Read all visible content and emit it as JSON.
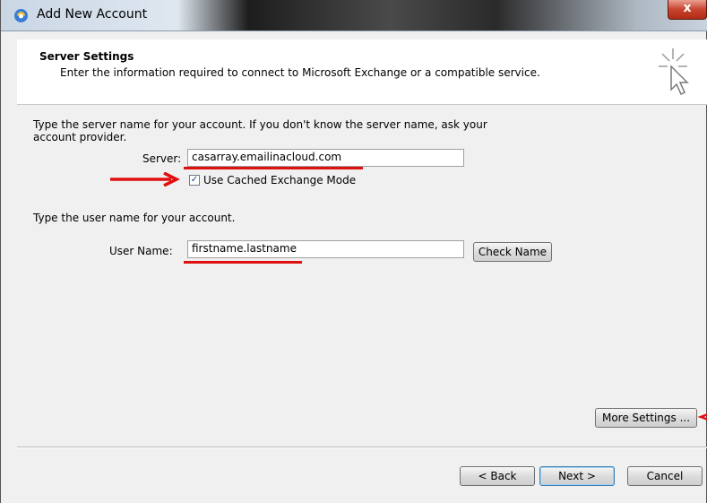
{
  "window": {
    "title": "Add New Account",
    "close_label": "x"
  },
  "header": {
    "title": "Server Settings",
    "description": "Enter the information required to connect to Microsoft Exchange or a compatible service."
  },
  "server": {
    "instructions_line1": "Type the server name for your account. If you don't know the server name, ask your",
    "instructions_line2": "account provider.",
    "label": "Server:",
    "value": "casarray.emailinacloud.com",
    "cached_mode_label": "Use Cached Exchange Mode",
    "cached_mode_checked": true
  },
  "user": {
    "instructions": "Type the user name for your account.",
    "label": "User Name:",
    "value": "firstname.lastname",
    "check_name_label": "Check Name"
  },
  "buttons": {
    "more_settings": "More Settings ...",
    "back": "< Back",
    "next": "Next >",
    "cancel": "Cancel"
  },
  "colors": {
    "annotation": "#e01010",
    "dialog_bg": "#f0f0f0"
  }
}
